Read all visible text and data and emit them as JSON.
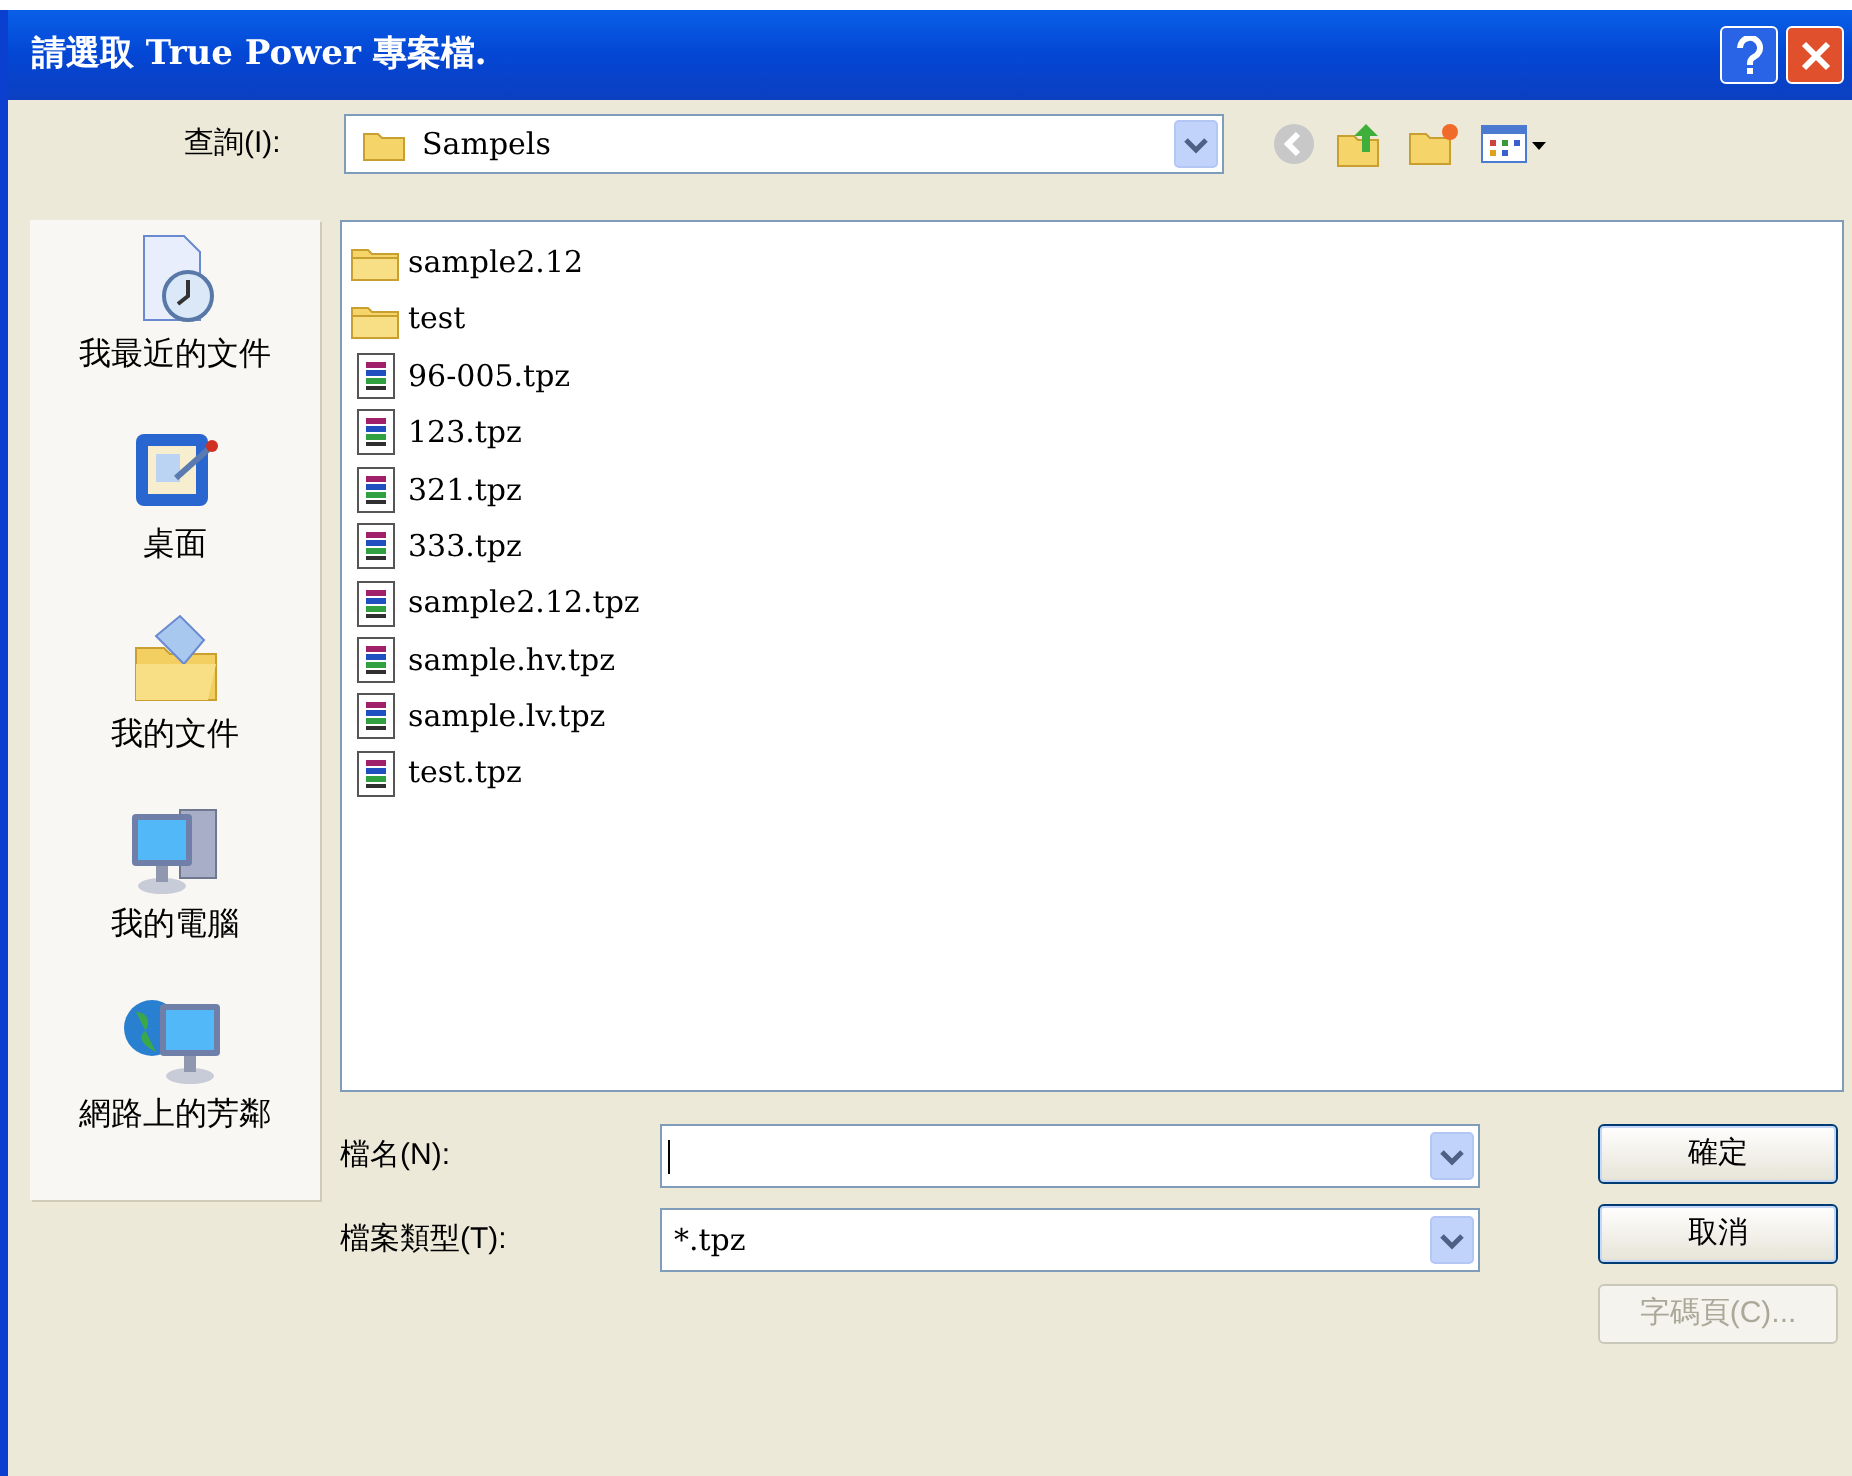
{
  "window": {
    "title": "請選取 True Power 專案檔."
  },
  "look_in": {
    "label": "查詢(I):",
    "value": "Sampels"
  },
  "places": [
    {
      "label": "我最近的文件",
      "kind": "recent"
    },
    {
      "label": "桌面",
      "kind": "desktop"
    },
    {
      "label": "我的文件",
      "kind": "documents"
    },
    {
      "label": "我的電腦",
      "kind": "computer"
    },
    {
      "label": "網路上的芳鄰",
      "kind": "network"
    }
  ],
  "files": [
    {
      "name": "sample2.12",
      "kind": "folder"
    },
    {
      "name": "test",
      "kind": "folder"
    },
    {
      "name": "96-005.tpz",
      "kind": "file"
    },
    {
      "name": "123.tpz",
      "kind": "file"
    },
    {
      "name": "321.tpz",
      "kind": "file"
    },
    {
      "name": "333.tpz",
      "kind": "file"
    },
    {
      "name": "sample2.12.tpz",
      "kind": "file"
    },
    {
      "name": "sample.hv.tpz",
      "kind": "file"
    },
    {
      "name": "sample.lv.tpz",
      "kind": "file"
    },
    {
      "name": "test.tpz",
      "kind": "file"
    }
  ],
  "file_name": {
    "label": "檔名(N):"
  },
  "file_type": {
    "label": "檔案類型(T):",
    "value": "*.tpz"
  },
  "buttons": [
    {
      "label": "確定",
      "disabled": false
    },
    {
      "label": "取消",
      "disabled": false
    },
    {
      "label": "字碼頁(C)...",
      "disabled": true
    }
  ]
}
